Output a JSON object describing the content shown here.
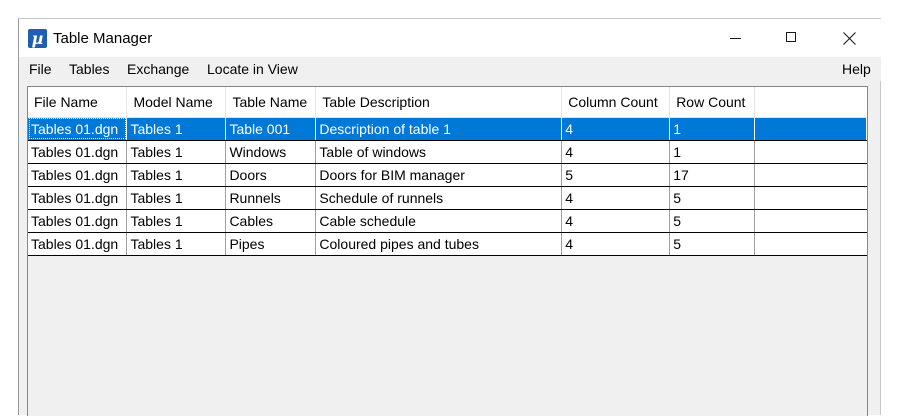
{
  "window": {
    "title": "Table Manager",
    "app_icon_glyph": "µ",
    "app_icon": "microstation-icon",
    "accent_color": "#0078d7"
  },
  "menubar": {
    "items": [
      {
        "label": "File"
      },
      {
        "label": "Tables"
      },
      {
        "label": "Exchange"
      },
      {
        "label": "Locate in View"
      }
    ],
    "help_label": "Help"
  },
  "table": {
    "columns": [
      "File Name",
      "Model Name",
      "Table Name",
      "Table Description",
      "Column Count",
      "Row Count"
    ],
    "selected_row": 0,
    "rows": [
      {
        "file": "Tables 01.dgn",
        "model": "Tables 1",
        "name": "Table  001",
        "description": "Description of table 1",
        "columns": "4",
        "rows": "1"
      },
      {
        "file": "Tables 01.dgn",
        "model": "Tables 1",
        "name": "Windows",
        "description": "Table of windows",
        "columns": "4",
        "rows": "1"
      },
      {
        "file": "Tables 01.dgn",
        "model": "Tables 1",
        "name": "Doors",
        "description": "Doors for BIM manager",
        "columns": "5",
        "rows": "17"
      },
      {
        "file": "Tables 01.dgn",
        "model": "Tables 1",
        "name": "Runnels",
        "description": "Schedule of runnels",
        "columns": "4",
        "rows": "5"
      },
      {
        "file": "Tables 01.dgn",
        "model": "Tables 1",
        "name": "Cables",
        "description": "Cable schedule",
        "columns": "4",
        "rows": "5"
      },
      {
        "file": "Tables 01.dgn",
        "model": "Tables 1",
        "name": "Pipes",
        "description": "Coloured pipes and tubes",
        "columns": "4",
        "rows": "5"
      }
    ]
  }
}
